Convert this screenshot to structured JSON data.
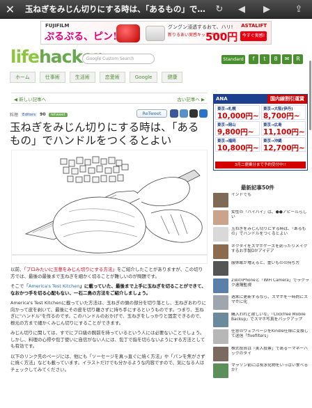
{
  "browser": {
    "title": "玉ねぎをみじん切りにする時は、「あるもの」で…",
    "close_icon": "✕",
    "reload_icon": "↻",
    "back_icon": "◀",
    "forward_icon": "▶",
    "share_icon": "⇪"
  },
  "banner": {
    "brand": "FUJIFILM",
    "tagline": "ぷるぷる、ピン!",
    "copy1": "グングン浸透するおて、ハリ!",
    "copy2": "新りるあい実感キット 今なら",
    "price": "500円",
    "astalift": "ASTALIFT",
    "cta": "今すぐ実感!"
  },
  "header": {
    "logo_a": "life",
    "logo_b": "hacker",
    "search_placeholder": "Google Custom Search",
    "edition": "Standard",
    "social": [
      "f",
      "t",
      "8",
      "✉",
      "R"
    ]
  },
  "nav": [
    "ホーム",
    "仕事術",
    "生活術",
    "恋愛術",
    "Google",
    "健康"
  ],
  "article": {
    "prev": "新しい記事へ",
    "next": "古い記事へ",
    "category": "料理",
    "source": "Editors",
    "count": "90",
    "retweet": "ReTweet",
    "headline": "玉ねぎをみじん切りにする時は、「あるもの」でハンドルをつくるとよい",
    "p1_a": "以前、",
    "p1_link": "「プロみたいに玉葱をみじん切りにする方法」",
    "p1_b": "をご紹介したことがありますが、この切り方では、最後の最後まで玉ねぎを細かく切ることが難しいのが問題です。",
    "p2_a": "そこで「",
    "p2_link": "America's Test Kitchen",
    "p2_b": "」に載っていた、最後まで上手に玉ねぎを切ることができて、なおかつ手を切る心配もない、一石二鳥の方法をご紹介しましょう。",
    "p3": "America's Test Kitchenに載っていた方法は、玉ねぎの頭の部分を切り落とし、玉ねぎおわりに向かって皮を剥いて、最後にその皮を切り離さずに持ち手にするというものです。つまり、玉ねぎに\"ハンドル\"を作るのです。このハンドルのおかげで、玉ねぎをしっかりと固定できるので、根元の方まで細かくみじん切りにすることができます。",
    "p4": "みじん切りに関しては、すでにプロ級の腕前を持っているという人には必要ないことでしょう。しかし、料理の心得や包丁使いに自信がない人には、包丁で指を切らないようにする方法としても有効です。",
    "p5": "以下のリンク先のページには、他にも「ソーセージを真っ直ぐに焼く方法」や「パンを焦がさずに焼く方法」なども載っています。イラストだけでも分かるような内容ですので、気になる人はチェックしてみてください。"
  },
  "sidebar_ad": {
    "airline": "ANA",
    "title": "国内線割引運賃",
    "routes": [
      {
        "route": "東京→札幌",
        "price": "10,000円~"
      },
      {
        "route": "東京→大阪(伊丹)",
        "price": "8,700円~"
      },
      {
        "route": "東京→岡山",
        "price": "9,800円~"
      },
      {
        "route": "東京→広島",
        "price": "11,100円~"
      },
      {
        "route": "東京→福岡",
        "price": "10,800円~"
      },
      {
        "route": "東京→沖縄",
        "price": "12,700円~"
      }
    ],
    "footer": "3月二便乗分まで予約受付中!!"
  },
  "latest": {
    "heading": "最新記事50件",
    "items": [
      {
        "text": "インドでも"
      },
      {
        "text": "女性の「バイバイ」は、●●アピールらしい"
      },
      {
        "text": "玉ねぎをみじん切りにする時は、「あるもの」でハンドルをつくるとよい"
      },
      {
        "text": "ネクタイをスマホケースを剤ったりメイクするお手製DIYアイデア"
      },
      {
        "text": "服休眠が増えると、重いものの持ち方"
      },
      {
        "text": "2台のiPhoneと「WiFi Camera」でラクラク遠隔監視"
      },
      {
        "text": "週末に更新するなら、スマホを一時的にスマホに化"
      },
      {
        "text": "購入われど欲しいな、「Clickfree Mobile Backup」でスマホ写真をバックアップ"
      },
      {
        "text": "任意のウェブページをKindle仕様に変換して送信「fivefilters」"
      },
      {
        "text": "株式投資は「美人投票」であるーマネーハックのタイ"
      },
      {
        "text": "マラソン前には炭水化物をいっぱい食べるか?"
      }
    ]
  }
}
